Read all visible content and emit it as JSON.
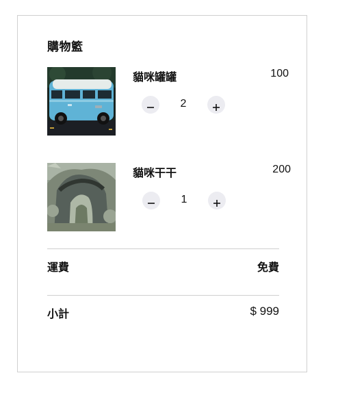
{
  "cart": {
    "title": "購物籃",
    "items": [
      {
        "name": "貓咪罐罐",
        "price": "100",
        "quantity": "2",
        "image_icon": "blue-van-photo-icon"
      },
      {
        "name": "貓咪干干",
        "price": "200",
        "quantity": "1",
        "image_icon": "rock-arch-photo-icon"
      }
    ],
    "shipping": {
      "label": "運費",
      "value": "免費"
    },
    "subtotal": {
      "label": "小計",
      "value": "$ 999"
    }
  }
}
